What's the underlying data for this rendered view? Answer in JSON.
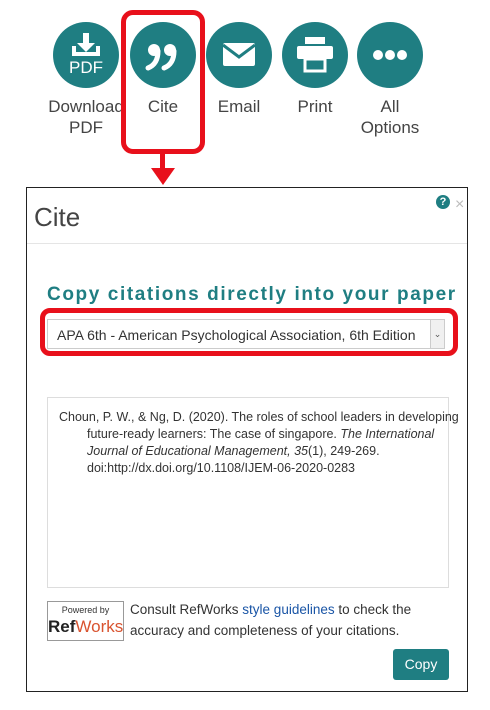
{
  "toolbar": {
    "download_label": "Download\nPDF",
    "download_icon_text": "PDF",
    "cite_label": "Cite",
    "email_label": "Email",
    "print_label": "Print",
    "all_options_label": "All\nOptions",
    "accent_color": "#1f7e82",
    "highlight_color": "#e8101b",
    "icons": [
      "download-pdf-icon",
      "quote-icon",
      "envelope-icon",
      "printer-icon",
      "ellipsis-icon"
    ]
  },
  "dialog": {
    "title": "Cite",
    "help_symbol": "?",
    "close_symbol": "×",
    "heading": "Copy citations directly into your paper",
    "style_select": {
      "selected": "APA 6th - American Psychological Association, 6th Edition"
    },
    "citation": {
      "authors": "Choun, P. W., & Ng, D. (2020). The roles of school leaders in developing future-ready learners: The case of singapore. ",
      "journal": "The International Journal of Educational Management, 35",
      "issue_pages": "(1), 249-269. doi:http://dx.doi.org/10.1108/IJEM-06-2020-0283"
    },
    "refworks": {
      "powered_by": "Powered by",
      "name_ref": "Ref",
      "name_works": "Works",
      "consult_prefix": "Consult RefWorks ",
      "consult_link": "style guidelines",
      "consult_suffix": " to check the accuracy and completeness of your citations."
    },
    "copy_button": "Copy"
  }
}
